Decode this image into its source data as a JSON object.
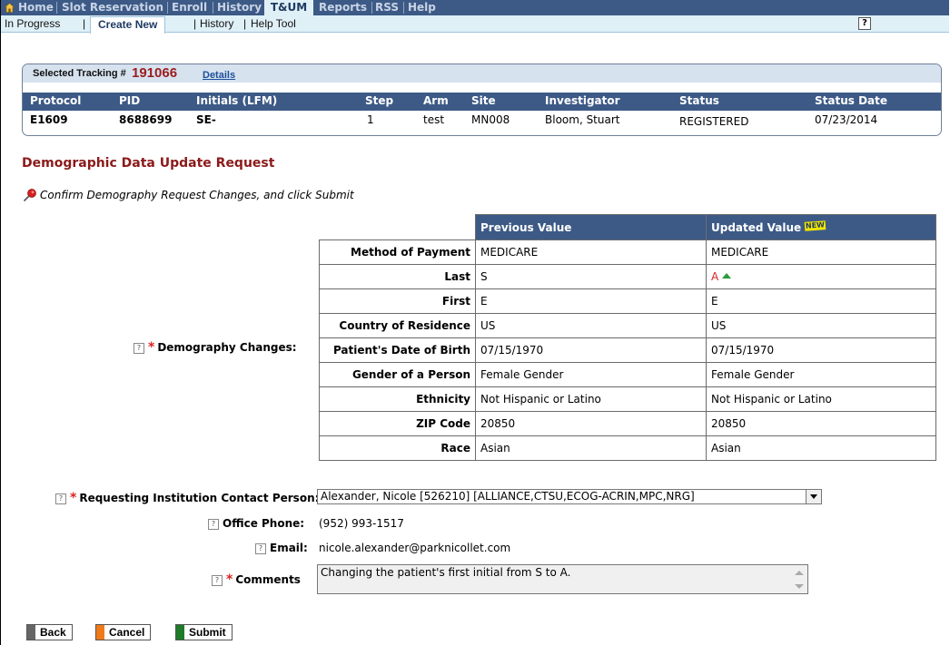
{
  "nav": {
    "tabs": [
      "Home",
      "Slot Reservation",
      "Enroll",
      "History",
      "T&UM",
      "Reports",
      "RSS",
      "Help"
    ],
    "active": "T&UM",
    "subtabs": [
      "In Progress",
      "Create New",
      "History",
      "Help Tool"
    ],
    "active_subtab": "Create New"
  },
  "tracking": {
    "label": "Selected Tracking #",
    "number": "191066",
    "details_link": "Details",
    "columns": [
      "Protocol",
      "PID",
      "Initials (LFM)",
      "Step",
      "Arm",
      "Site",
      "Investigator",
      "Status",
      "Status Date"
    ],
    "values": [
      "E1609",
      "8688699",
      "SE-",
      "1",
      "test",
      "MN008",
      "Bloom, Stuart",
      "REGISTERED",
      "07/23/2014"
    ]
  },
  "section_title": "Demographic Data Update Request",
  "instruction": "Confirm Demography Request Changes, and click Submit",
  "demography": {
    "label": "Demography Changes:",
    "col_previous": "Previous Value",
    "col_updated": "Updated Value",
    "new_badge": "NEW",
    "rows": [
      {
        "key": "Method of Payment",
        "prev": "MEDICARE",
        "updated": "MEDICARE"
      },
      {
        "key": "Last",
        "prev": "S",
        "updated": "A"
      },
      {
        "key": "First",
        "prev": "E",
        "updated": "E"
      },
      {
        "key": "Country of Residence",
        "prev": "US",
        "updated": "US"
      },
      {
        "key": "Patient's Date of Birth",
        "prev": "07/15/1970",
        "updated": "07/15/1970"
      },
      {
        "key": "Gender of a Person",
        "prev": "Female Gender",
        "updated": "Female Gender"
      },
      {
        "key": "Ethnicity",
        "prev": "Not Hispanic or Latino",
        "updated": "Not Hispanic or Latino"
      },
      {
        "key": "ZIP Code",
        "prev": "20850",
        "updated": "20850"
      },
      {
        "key": "Race",
        "prev": "Asian",
        "updated": "Asian"
      }
    ]
  },
  "contact": {
    "label": "Requesting Institution Contact Person:",
    "selected": "Alexander, Nicole [526210] [ALLIANCE,CTSU,ECOG-ACRIN,MPC,NRG]"
  },
  "phone": {
    "label": "Office Phone:",
    "value": "(952) 993-1517"
  },
  "email": {
    "label": "Email:",
    "value": "nicole.alexander@parknicollet.com"
  },
  "comments": {
    "label": "Comments",
    "value": "Changing the patient's first initial from S to A."
  },
  "buttons": {
    "back": "Back",
    "cancel": "Cancel",
    "submit": "Submit"
  },
  "colors": {
    "nav": "#3d5a86",
    "accent_red": "#8b1a1a",
    "cancel": "#f07a1a",
    "submit": "#1f7a2a",
    "back": "#666666"
  }
}
